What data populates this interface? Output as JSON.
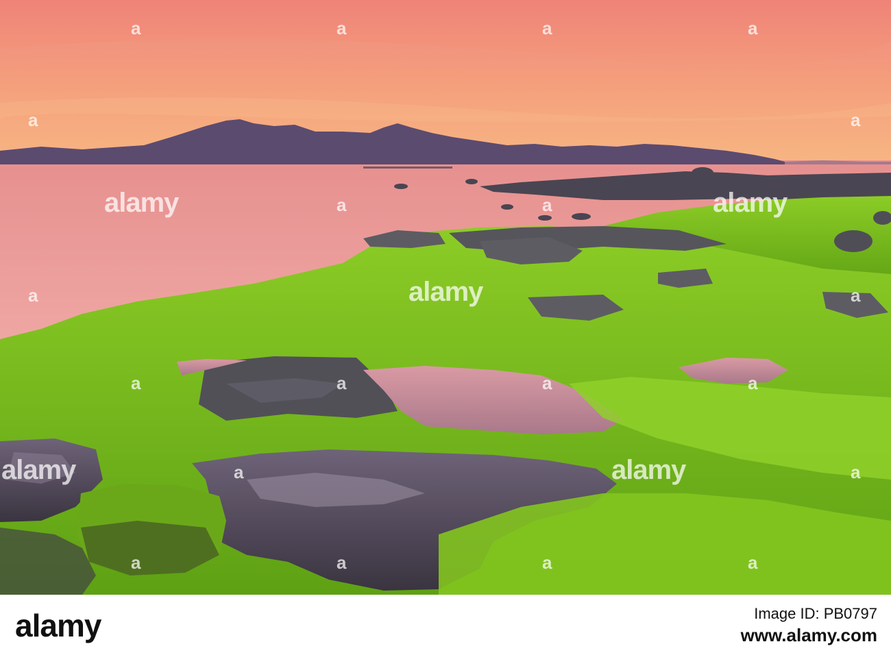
{
  "photo": {
    "subject": "sunset seascape with mountains and algae-covered rocks",
    "colors": {
      "sky_top": "#f08c7e",
      "sky_horizon": "#f6b07a",
      "mountain": "#5a4a6e",
      "sea": "#e99a98",
      "algae": "#79c21d",
      "rock": "#55545a",
      "pool": "#c98a95"
    }
  },
  "watermark": {
    "text": "alamy",
    "glyph": "a"
  },
  "footer": {
    "logo": "alamy",
    "line1": "Image ID: PB0797",
    "line2": "www.alamy.com"
  }
}
